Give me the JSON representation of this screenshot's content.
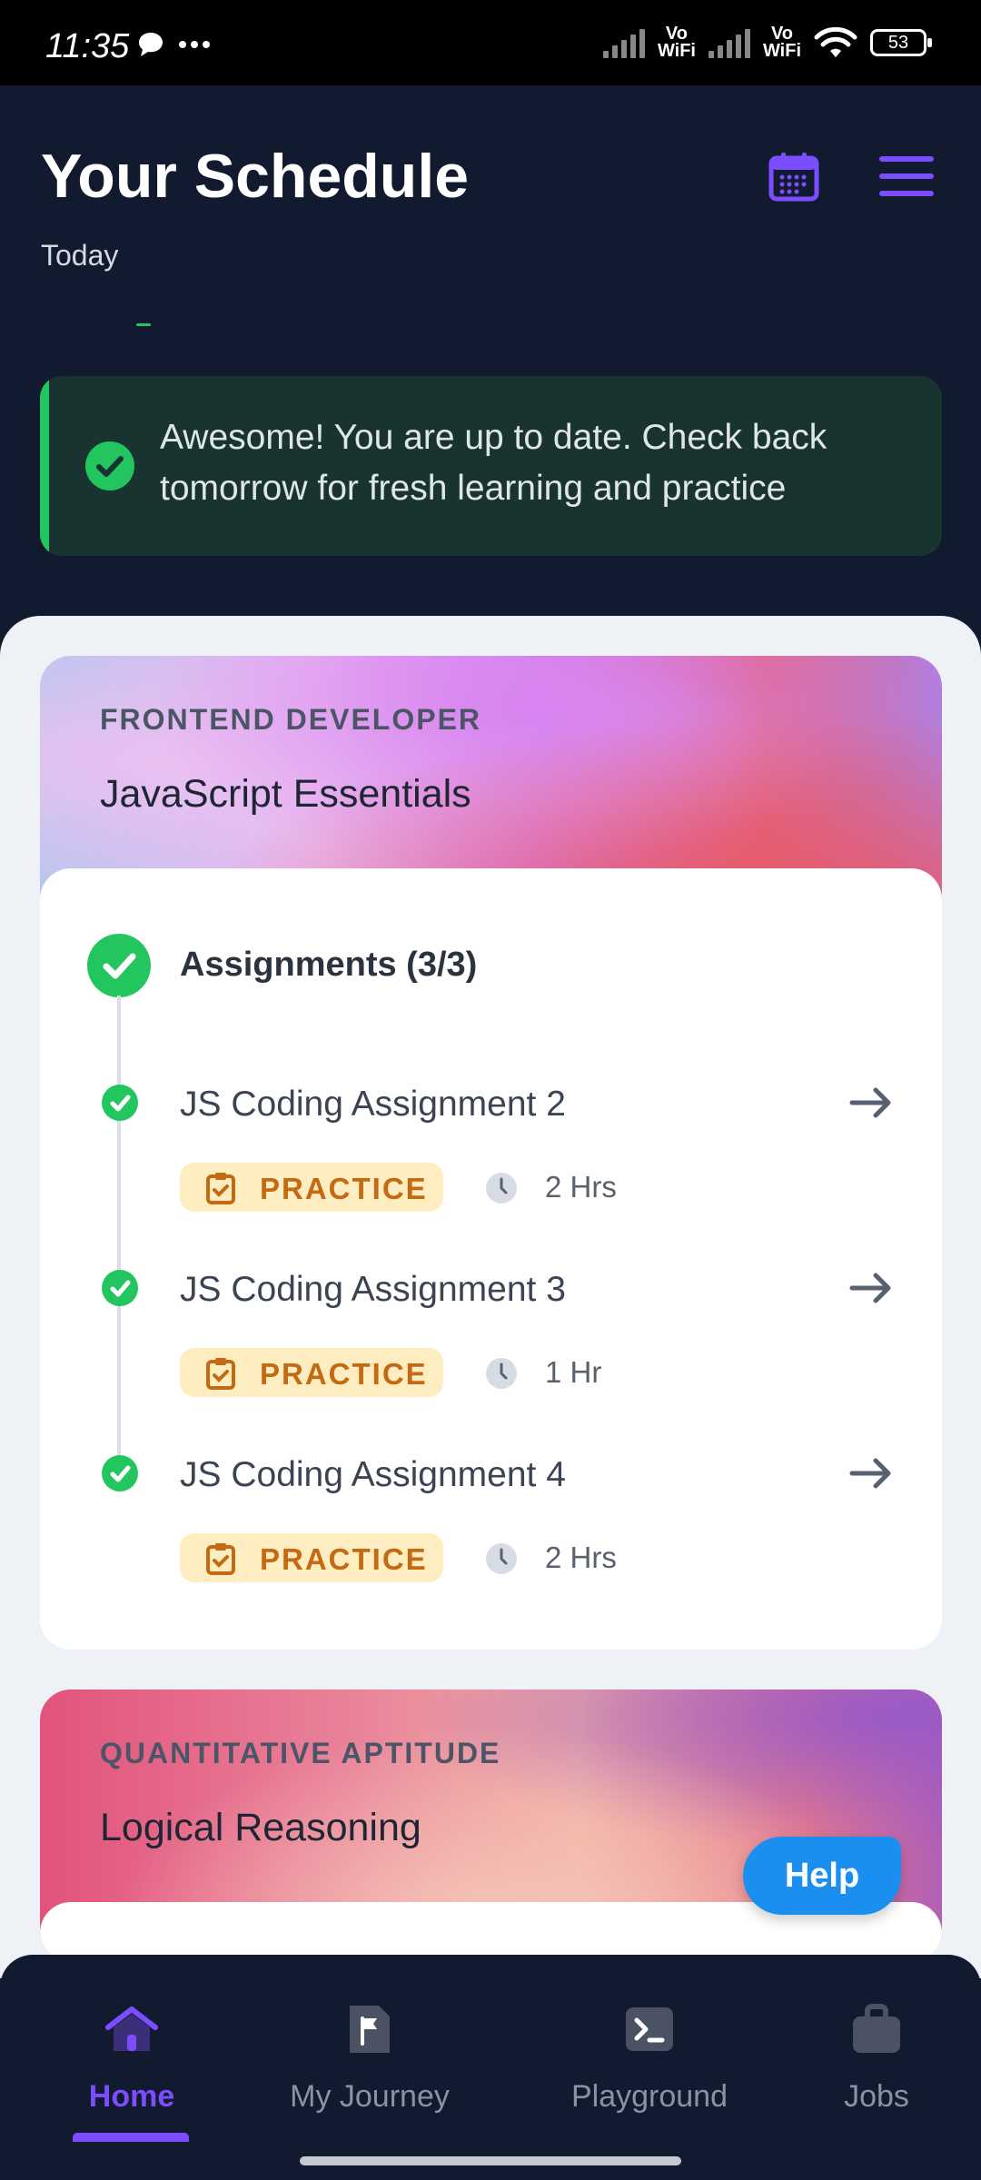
{
  "status_bar": {
    "time": "11:35",
    "battery": "53",
    "vowifi_1": "Vo\nWiFi",
    "vowifi_2": "Vo\nWiFi"
  },
  "header": {
    "title": "Your Schedule",
    "subtitle": "Today"
  },
  "banner": {
    "message": "Awesome! You are up to date. Check back tomorrow for fresh learning and practice"
  },
  "cards": [
    {
      "eyebrow": "FRONTEND DEVELOPER",
      "title": "JavaScript Essentials",
      "section_title": "Assignments (3/3)",
      "tasks": [
        {
          "title": "JS Coding Assignment 2",
          "badge": "PRACTICE",
          "duration": "2 Hrs"
        },
        {
          "title": "JS Coding Assignment 3",
          "badge": "PRACTICE",
          "duration": "1 Hr"
        },
        {
          "title": "JS Coding Assignment 4",
          "badge": "PRACTICE",
          "duration": "2 Hrs"
        }
      ]
    },
    {
      "eyebrow": "QUANTITATIVE APTITUDE",
      "title": "Logical Reasoning"
    }
  ],
  "help_button": "Help",
  "nav": {
    "home": "Home",
    "journey": "My Journey",
    "playground": "Playground",
    "jobs": "Jobs",
    "active": "Home"
  },
  "colors": {
    "accent": "#7c4dff",
    "success": "#22c55e",
    "practice_badge_bg": "#fdedc1",
    "practice_badge_text": "#c46a12",
    "help": "#1b8ff0"
  }
}
